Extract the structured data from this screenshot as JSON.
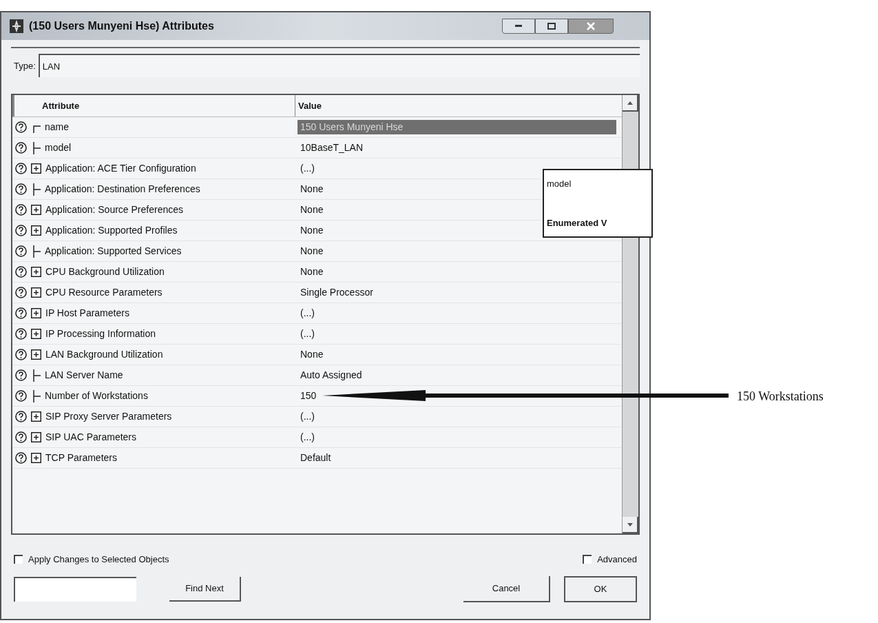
{
  "window": {
    "title": "(150 Users Munyeni Hse) Attributes"
  },
  "type_field": {
    "label": "Type:",
    "value": "LAN"
  },
  "table": {
    "columns": [
      "Attribute",
      "Value"
    ],
    "rows": [
      {
        "kind": "top",
        "attribute": "name",
        "value": "150 Users Munyeni Hse",
        "selected": true
      },
      {
        "kind": "branch",
        "attribute": "model",
        "value": "10BaseT_LAN",
        "selected": false
      },
      {
        "kind": "expandable",
        "attribute": "Application: ACE Tier Configuration",
        "value": "(...)",
        "selected": false
      },
      {
        "kind": "branch",
        "attribute": "Application: Destination Preferences",
        "value": "None",
        "selected": false
      },
      {
        "kind": "expandable",
        "attribute": "Application: Source Preferences",
        "value": "None",
        "selected": false
      },
      {
        "kind": "expandable",
        "attribute": "Application: Supported Profiles",
        "value": "None",
        "selected": false
      },
      {
        "kind": "branch",
        "attribute": "Application: Supported Services",
        "value": "None",
        "selected": false
      },
      {
        "kind": "expandable",
        "attribute": "CPU Background Utilization",
        "value": "None",
        "selected": false
      },
      {
        "kind": "expandable",
        "attribute": "CPU Resource Parameters",
        "value": "Single Processor",
        "selected": false
      },
      {
        "kind": "expandable",
        "attribute": "IP Host Parameters",
        "value": "(...)",
        "selected": false
      },
      {
        "kind": "expandable",
        "attribute": "IP Processing Information",
        "value": "(...)",
        "selected": false
      },
      {
        "kind": "expandable",
        "attribute": "LAN Background Utilization",
        "value": "None",
        "selected": false
      },
      {
        "kind": "branch",
        "attribute": "LAN Server Name",
        "value": "Auto Assigned",
        "selected": false
      },
      {
        "kind": "branch",
        "attribute": "Number of Workstations",
        "value": "150",
        "selected": false
      },
      {
        "kind": "expandable",
        "attribute": "SIP Proxy Server Parameters",
        "value": "(...)",
        "selected": false
      },
      {
        "kind": "expandable",
        "attribute": "SIP UAC Parameters",
        "value": "(...)",
        "selected": false
      },
      {
        "kind": "expandable",
        "attribute": "TCP Parameters",
        "value": "Default",
        "selected": false
      }
    ]
  },
  "tooltip": {
    "lines": [
      "model",
      "Enumerated V"
    ]
  },
  "options": [
    {
      "label": "Apply Changes to Selected Objects",
      "checked": false
    },
    {
      "label": "Advanced",
      "checked": false
    }
  ],
  "buttons": [
    "Find Next",
    "Cancel",
    "OK"
  ],
  "annotation": {
    "label": "150 Workstations"
  }
}
